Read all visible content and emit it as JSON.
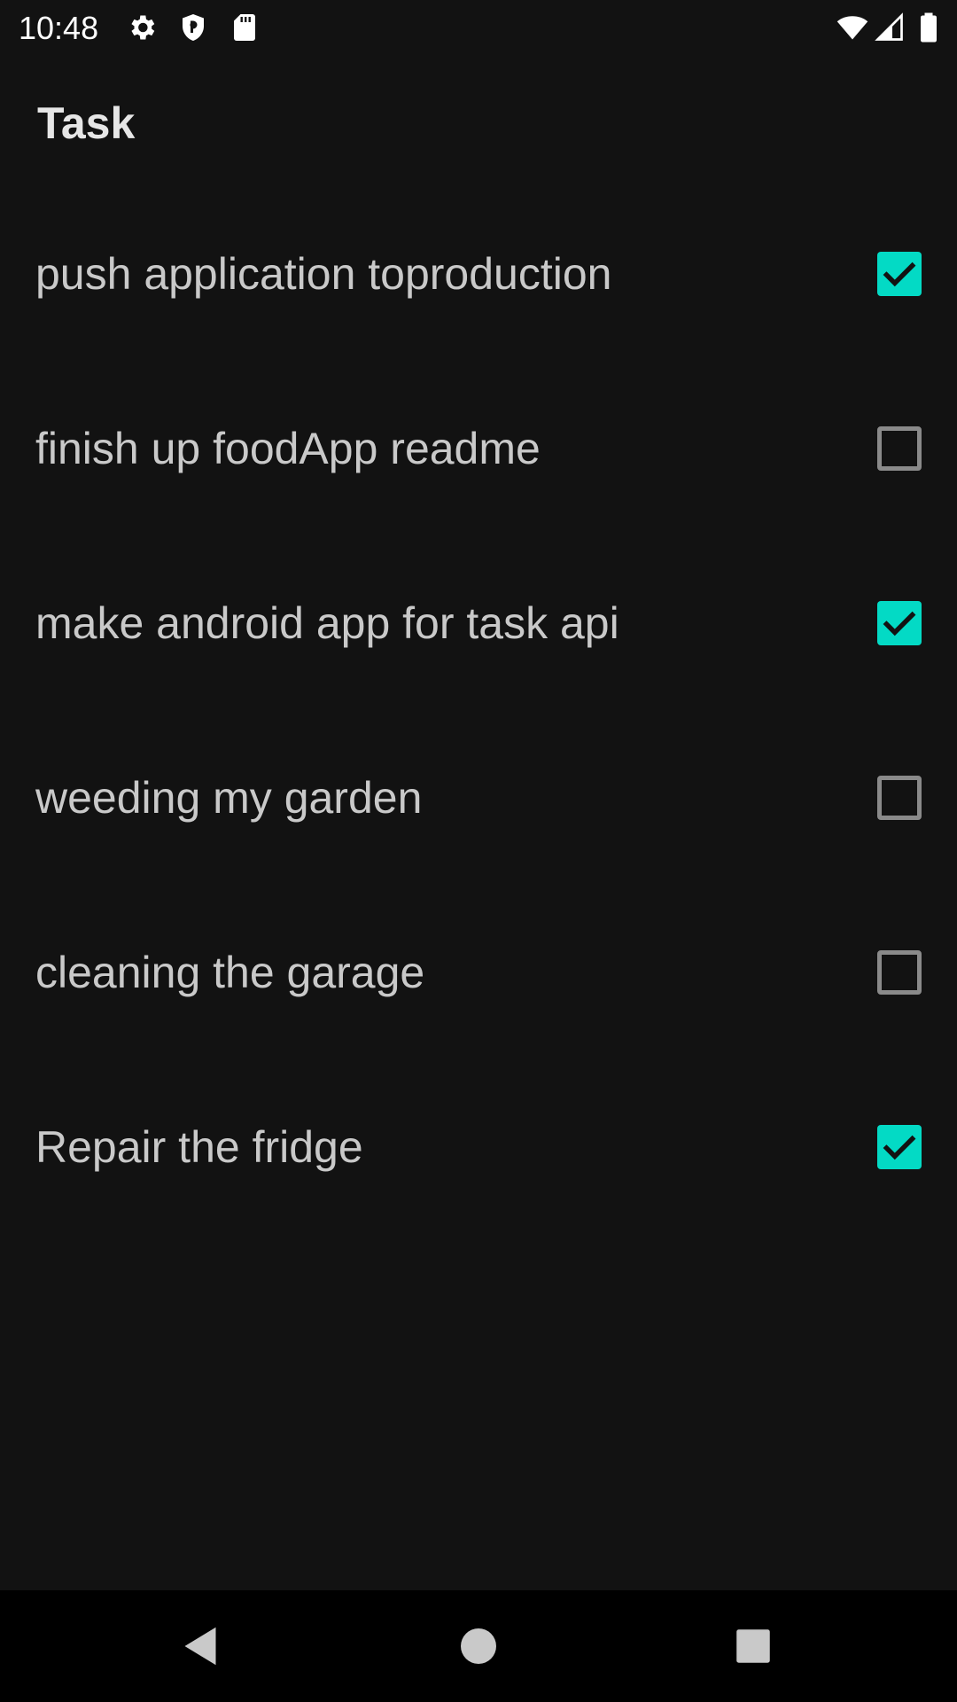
{
  "status_bar": {
    "time": "10:48",
    "left_icons": [
      "gear-icon",
      "shield-icon",
      "sd-card-icon"
    ],
    "right_icons": [
      "wifi-icon",
      "cell-signal-icon",
      "battery-icon"
    ]
  },
  "app_bar": {
    "title": "Task"
  },
  "tasks": [
    {
      "label": "push application toproduction",
      "checked": true
    },
    {
      "label": "finish up foodApp readme",
      "checked": false
    },
    {
      "label": "make android app for task api",
      "checked": true
    },
    {
      "label": "weeding my garden",
      "checked": false
    },
    {
      "label": "cleaning the garage",
      "checked": false
    },
    {
      "label": "Repair the fridge",
      "checked": true
    }
  ],
  "nav_bar": {
    "buttons": [
      "back-icon",
      "home-icon",
      "recents-icon"
    ]
  },
  "colors": {
    "background": "#121212",
    "accent": "#03dac5",
    "text": "#c9c9c9",
    "checkbox_border": "#8a8a8a",
    "nav_background": "#000000"
  }
}
